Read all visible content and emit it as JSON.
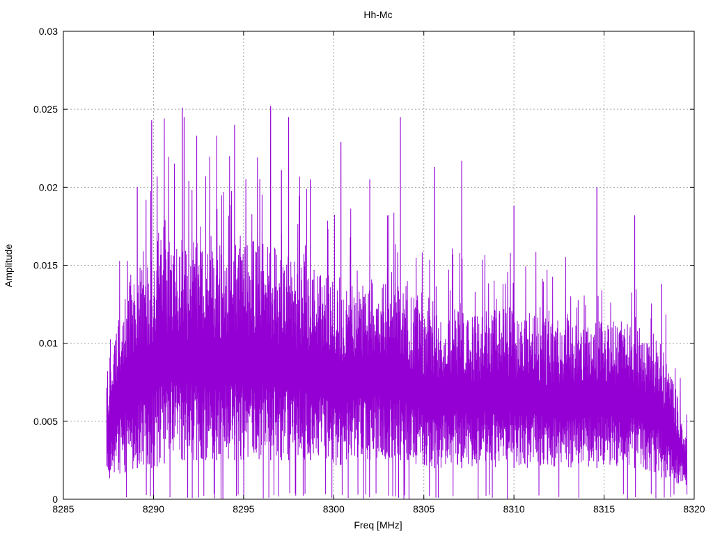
{
  "chart_data": {
    "type": "line",
    "title": "Hh-Mc",
    "xlabel": "Freq [MHz]",
    "ylabel": "Amplitude",
    "xlim": [
      8285,
      8320
    ],
    "ylim": [
      0,
      0.03
    ],
    "x_ticks": [
      8285,
      8290,
      8295,
      8300,
      8305,
      8310,
      8315,
      8320
    ],
    "x_tick_labels": [
      "8285",
      "8290",
      "8295",
      "8300",
      "8305",
      "8310",
      "8315",
      "8320"
    ],
    "y_ticks": [
      0,
      0.005,
      0.01,
      0.015,
      0.02,
      0.025,
      0.03
    ],
    "y_tick_labels": [
      "0",
      "0.005",
      "0.01",
      "0.015",
      "0.02",
      "0.025",
      "0.03"
    ],
    "grid": true,
    "legend": "none",
    "series": [
      {
        "color": "#9400d3",
        "x_range": [
          8287.4,
          8319.6
        ],
        "envelope": {
          "x": [
            8287.4,
            8288.0,
            8289.0,
            8290.0,
            8291.0,
            8292.0,
            8293.0,
            8294.0,
            8295.0,
            8296.0,
            8297.0,
            8298.0,
            8299.0,
            8300.0,
            8301.0,
            8302.0,
            8303.0,
            8304.0,
            8305.0,
            8306.0,
            8307.0,
            8308.0,
            8309.0,
            8310.0,
            8311.0,
            8312.0,
            8313.0,
            8314.0,
            8315.0,
            8316.0,
            8317.0,
            8318.0,
            8319.0,
            8319.6
          ],
          "upper": [
            0.006,
            0.012,
            0.0155,
            0.0165,
            0.017,
            0.0165,
            0.0165,
            0.0165,
            0.017,
            0.0165,
            0.016,
            0.0155,
            0.015,
            0.0145,
            0.014,
            0.0145,
            0.014,
            0.0135,
            0.0125,
            0.012,
            0.0125,
            0.012,
            0.0125,
            0.0125,
            0.012,
            0.0115,
            0.012,
            0.0115,
            0.0115,
            0.0115,
            0.011,
            0.0105,
            0.007,
            0.004
          ],
          "lower": [
            0.001,
            0.0015,
            0.002,
            0.002,
            0.0025,
            0.0025,
            0.0025,
            0.0025,
            0.0025,
            0.0025,
            0.0025,
            0.0025,
            0.0025,
            0.002,
            0.0025,
            0.0025,
            0.0025,
            0.0025,
            0.002,
            0.002,
            0.002,
            0.002,
            0.002,
            0.002,
            0.002,
            0.002,
            0.002,
            0.002,
            0.002,
            0.002,
            0.002,
            0.0015,
            0.001,
            0.0005
          ]
        },
        "peaks": [
          {
            "x": 8289.9,
            "y": 0.0243
          },
          {
            "x": 8290.6,
            "y": 0.0244
          },
          {
            "x": 8291.6,
            "y": 0.0251
          },
          {
            "x": 8291.7,
            "y": 0.0245
          },
          {
            "x": 8292.4,
            "y": 0.0233
          },
          {
            "x": 8293.5,
            "y": 0.0233
          },
          {
            "x": 8294.5,
            "y": 0.024
          },
          {
            "x": 8296.5,
            "y": 0.0252
          },
          {
            "x": 8297.5,
            "y": 0.0245
          },
          {
            "x": 8300.4,
            "y": 0.0229
          },
          {
            "x": 8303.7,
            "y": 0.0245
          },
          {
            "x": 8307.1,
            "y": 0.0217
          },
          {
            "x": 8310.0,
            "y": 0.0188
          },
          {
            "x": 8314.6,
            "y": 0.02
          },
          {
            "x": 8316.7,
            "y": 0.0182
          },
          {
            "x": 8289.1,
            "y": 0.02
          },
          {
            "x": 8290.2,
            "y": 0.0207
          },
          {
            "x": 8292.9,
            "y": 0.0207
          },
          {
            "x": 8297.1,
            "y": 0.0211
          },
          {
            "x": 8298.7,
            "y": 0.0205
          },
          {
            "x": 8302.0,
            "y": 0.0205
          },
          {
            "x": 8305.6,
            "y": 0.0213
          },
          {
            "x": 8318.2,
            "y": 0.0138
          }
        ],
        "dips": [
          8290.0,
          8291.9,
          8296.4,
          8299.9,
          8303.6,
          8305.8,
          8308.8,
          8313.6
        ]
      }
    ]
  }
}
